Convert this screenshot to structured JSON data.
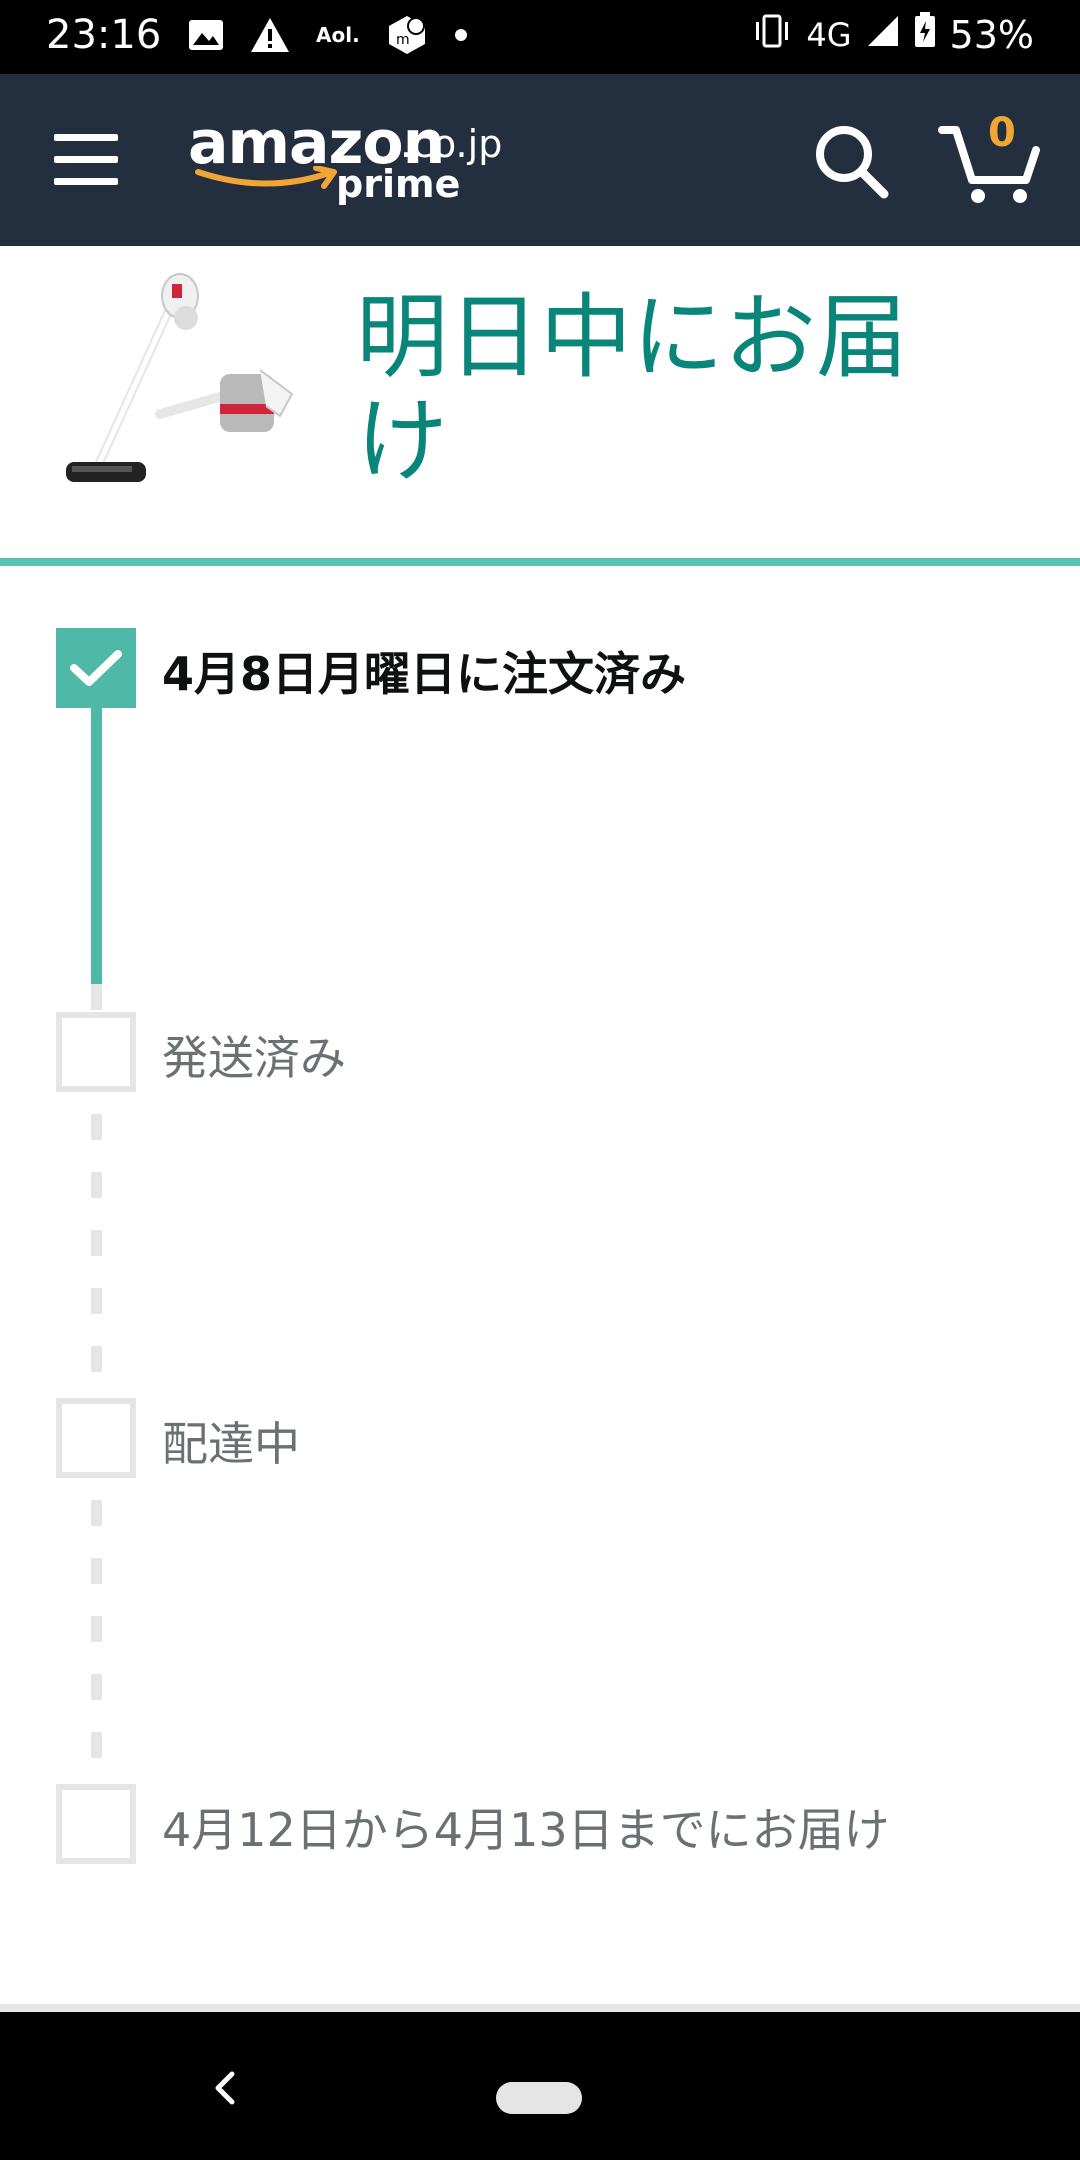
{
  "status_bar": {
    "time": "23:16",
    "left_icons": [
      "image-icon",
      "warning-icon",
      "aol-icon",
      "m-app-icon",
      "dot-icon"
    ],
    "aol_label": "Aol.",
    "network": "4G",
    "battery": "53%"
  },
  "header": {
    "logo_text": "amazon",
    "logo_domain": ".co.jp",
    "logo_sub": "prime",
    "cart_count": "0",
    "colors": {
      "background": "#232f3e",
      "cart_count": "#f0a534"
    }
  },
  "banner": {
    "title": "明日中にお届け",
    "title_color": "#0a857a",
    "accent": "#56c2b2"
  },
  "tracker": {
    "steps": [
      {
        "label": "4月8日月曜日に注文済み",
        "state": "done"
      },
      {
        "label": "発送済み",
        "state": "pending"
      },
      {
        "label": "配達中",
        "state": "pending"
      },
      {
        "label": "4月12日から4月13日までにお届け",
        "state": "pending"
      }
    ]
  }
}
